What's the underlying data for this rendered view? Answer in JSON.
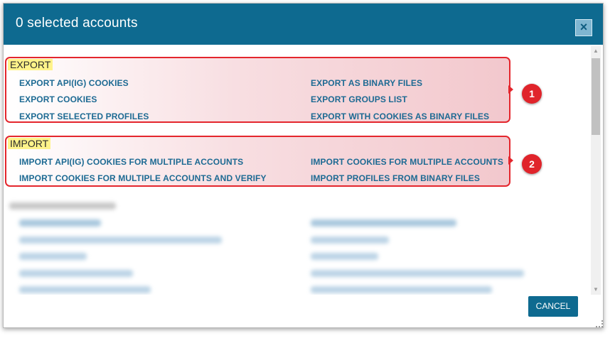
{
  "dialog": {
    "title": "0 selected accounts",
    "close_icon": "×",
    "cancel_label": "CANCEL"
  },
  "export": {
    "label": "EXPORT",
    "badge": "1",
    "left_links": [
      "EXPORT API(IG) COOKIES",
      "EXPORT COOKIES",
      "EXPORT SELECTED PROFILES"
    ],
    "right_links": [
      "EXPORT AS BINARY FILES",
      "EXPORT GROUPS LIST",
      "EXPORT WITH COOKIES AS BINARY FILES"
    ]
  },
  "import": {
    "label": "IMPORT",
    "badge": "2",
    "left_links": [
      "IMPORT API(IG) COOKIES FOR MULTIPLE ACCOUNTS",
      "IMPORT COOKIES FOR MULTIPLE ACCOUNTS AND VERIFY"
    ],
    "right_links": [
      "IMPORT COOKIES FOR MULTIPLE ACCOUNTS",
      "IMPORT PROFILES FROM BINARY FILES"
    ]
  },
  "scrollbar": {
    "up_icon": "▲",
    "down_icon": "▼"
  },
  "colors": {
    "header": "#0e6a90",
    "link": "#1d6a93",
    "highlight_border": "#e4262d",
    "label_highlight": "#fff38a",
    "badge": "#e0242b"
  }
}
